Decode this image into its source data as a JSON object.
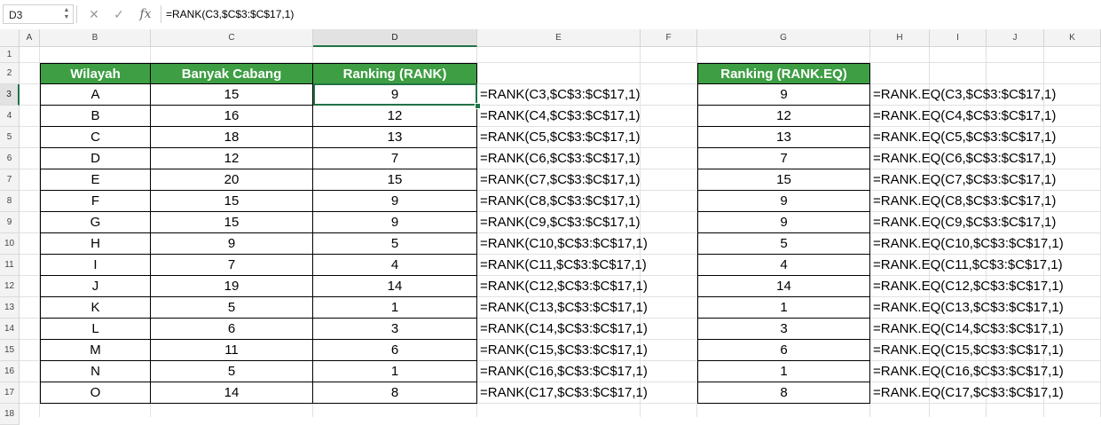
{
  "formula_bar": {
    "name_box": "D3",
    "cancel_icon": "✕",
    "enter_icon": "✓",
    "fx_label": "fx",
    "formula": "=RANK(C3,$C$3:$C$17,1)"
  },
  "columns": [
    "A",
    "B",
    "C",
    "D",
    "E",
    "F",
    "G",
    "H",
    "I",
    "J",
    "K"
  ],
  "rows": [
    "1",
    "2",
    "3",
    "4",
    "5",
    "6",
    "7",
    "8",
    "9",
    "10",
    "11",
    "12",
    "13",
    "14",
    "15",
    "16",
    "17",
    "18"
  ],
  "selected": {
    "column": "D",
    "row": "3"
  },
  "colors": {
    "header_fill": "#3d9e43",
    "header_text": "#ffffff",
    "selection": "#217346"
  },
  "table1": {
    "headers": [
      "Wilayah",
      "Banyak Cabang",
      "Ranking (RANK)"
    ],
    "rows": [
      {
        "wilayah": "A",
        "cabang": "15",
        "rank": "9",
        "formula": "=RANK(C3,$C$3:$C$17,1)"
      },
      {
        "wilayah": "B",
        "cabang": "16",
        "rank": "12",
        "formula": "=RANK(C4,$C$3:$C$17,1)"
      },
      {
        "wilayah": "C",
        "cabang": "18",
        "rank": "13",
        "formula": "=RANK(C5,$C$3:$C$17,1)"
      },
      {
        "wilayah": "D",
        "cabang": "12",
        "rank": "7",
        "formula": "=RANK(C6,$C$3:$C$17,1)"
      },
      {
        "wilayah": "E",
        "cabang": "20",
        "rank": "15",
        "formula": "=RANK(C7,$C$3:$C$17,1)"
      },
      {
        "wilayah": "F",
        "cabang": "15",
        "rank": "9",
        "formula": "=RANK(C8,$C$3:$C$17,1)"
      },
      {
        "wilayah": "G",
        "cabang": "15",
        "rank": "9",
        "formula": "=RANK(C9,$C$3:$C$17,1)"
      },
      {
        "wilayah": "H",
        "cabang": "9",
        "rank": "5",
        "formula": "=RANK(C10,$C$3:$C$17,1)"
      },
      {
        "wilayah": "I",
        "cabang": "7",
        "rank": "4",
        "formula": "=RANK(C11,$C$3:$C$17,1)"
      },
      {
        "wilayah": "J",
        "cabang": "19",
        "rank": "14",
        "formula": "=RANK(C12,$C$3:$C$17,1)"
      },
      {
        "wilayah": "K",
        "cabang": "5",
        "rank": "1",
        "formula": "=RANK(C13,$C$3:$C$17,1)"
      },
      {
        "wilayah": "L",
        "cabang": "6",
        "rank": "3",
        "formula": "=RANK(C14,$C$3:$C$17,1)"
      },
      {
        "wilayah": "M",
        "cabang": "11",
        "rank": "6",
        "formula": "=RANK(C15,$C$3:$C$17,1)"
      },
      {
        "wilayah": "N",
        "cabang": "5",
        "rank": "1",
        "formula": "=RANK(C16,$C$3:$C$17,1)"
      },
      {
        "wilayah": "O",
        "cabang": "14",
        "rank": "8",
        "formula": "=RANK(C17,$C$3:$C$17,1)"
      }
    ]
  },
  "table2": {
    "header": "Ranking (RANK.EQ)",
    "rows": [
      {
        "rank": "9",
        "formula": "=RANK.EQ(C3,$C$3:$C$17,1)"
      },
      {
        "rank": "12",
        "formula": "=RANK.EQ(C4,$C$3:$C$17,1)"
      },
      {
        "rank": "13",
        "formula": "=RANK.EQ(C5,$C$3:$C$17,1)"
      },
      {
        "rank": "7",
        "formula": "=RANK.EQ(C6,$C$3:$C$17,1)"
      },
      {
        "rank": "15",
        "formula": "=RANK.EQ(C7,$C$3:$C$17,1)"
      },
      {
        "rank": "9",
        "formula": "=RANK.EQ(C8,$C$3:$C$17,1)"
      },
      {
        "rank": "9",
        "formula": "=RANK.EQ(C9,$C$3:$C$17,1)"
      },
      {
        "rank": "5",
        "formula": "=RANK.EQ(C10,$C$3:$C$17,1)"
      },
      {
        "rank": "4",
        "formula": "=RANK.EQ(C11,$C$3:$C$17,1)"
      },
      {
        "rank": "14",
        "formula": "=RANK.EQ(C12,$C$3:$C$17,1)"
      },
      {
        "rank": "1",
        "formula": "=RANK.EQ(C13,$C$3:$C$17,1)"
      },
      {
        "rank": "3",
        "formula": "=RANK.EQ(C14,$C$3:$C$17,1)"
      },
      {
        "rank": "6",
        "formula": "=RANK.EQ(C15,$C$3:$C$17,1)"
      },
      {
        "rank": "1",
        "formula": "=RANK.EQ(C16,$C$3:$C$17,1)"
      },
      {
        "rank": "8",
        "formula": "=RANK.EQ(C17,$C$3:$C$17,1)"
      }
    ]
  }
}
